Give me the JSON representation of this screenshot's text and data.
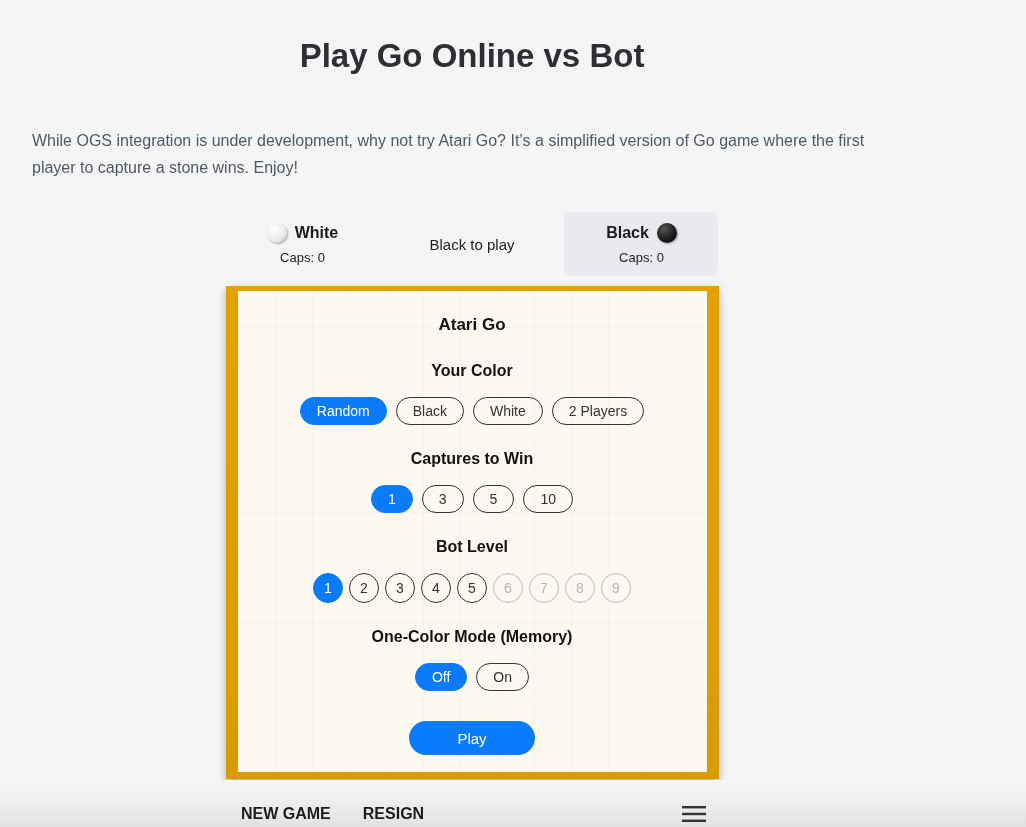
{
  "page": {
    "title": "Play Go Online vs Bot",
    "intro": "While OGS integration is under development, why not try Atari Go? It’s a simplified version of Go game where the first player to capture a stone wins. Enjoy!"
  },
  "players": [
    {
      "name": "White",
      "kind": "white",
      "caps": "Caps: 0",
      "active": false
    },
    {
      "name": "Black",
      "kind": "black",
      "caps": "Caps: 0",
      "active": true
    }
  ],
  "status": "Black to play",
  "setup": {
    "title": "Atari Go",
    "groups": [
      {
        "label": "Your Color",
        "kind": "pill",
        "options": [
          {
            "label": "Random",
            "selected": true
          },
          {
            "label": "Black",
            "selected": false
          },
          {
            "label": "White",
            "selected": false
          },
          {
            "label": "2 Players",
            "selected": false
          }
        ]
      },
      {
        "label": "Captures to Win",
        "kind": "pill",
        "options": [
          {
            "label": "1",
            "selected": true
          },
          {
            "label": "3",
            "selected": false
          },
          {
            "label": "5",
            "selected": false
          },
          {
            "label": "10",
            "selected": false
          }
        ]
      },
      {
        "label": "Bot Level",
        "kind": "circle",
        "options": [
          {
            "label": "1",
            "selected": true,
            "disabled": false
          },
          {
            "label": "2",
            "selected": false,
            "disabled": false
          },
          {
            "label": "3",
            "selected": false,
            "disabled": false
          },
          {
            "label": "4",
            "selected": false,
            "disabled": false
          },
          {
            "label": "5",
            "selected": false,
            "disabled": false
          },
          {
            "label": "6",
            "selected": false,
            "disabled": true
          },
          {
            "label": "7",
            "selected": false,
            "disabled": true
          },
          {
            "label": "8",
            "selected": false,
            "disabled": true
          },
          {
            "label": "9",
            "selected": false,
            "disabled": true
          }
        ]
      },
      {
        "label": "One-Color Mode (Memory)",
        "kind": "pill",
        "options": [
          {
            "label": "Off",
            "selected": true
          },
          {
            "label": "On",
            "selected": false
          }
        ]
      }
    ],
    "play_button": "Play"
  },
  "footer": {
    "actions": [
      "NEW GAME",
      "RESIGN"
    ]
  }
}
